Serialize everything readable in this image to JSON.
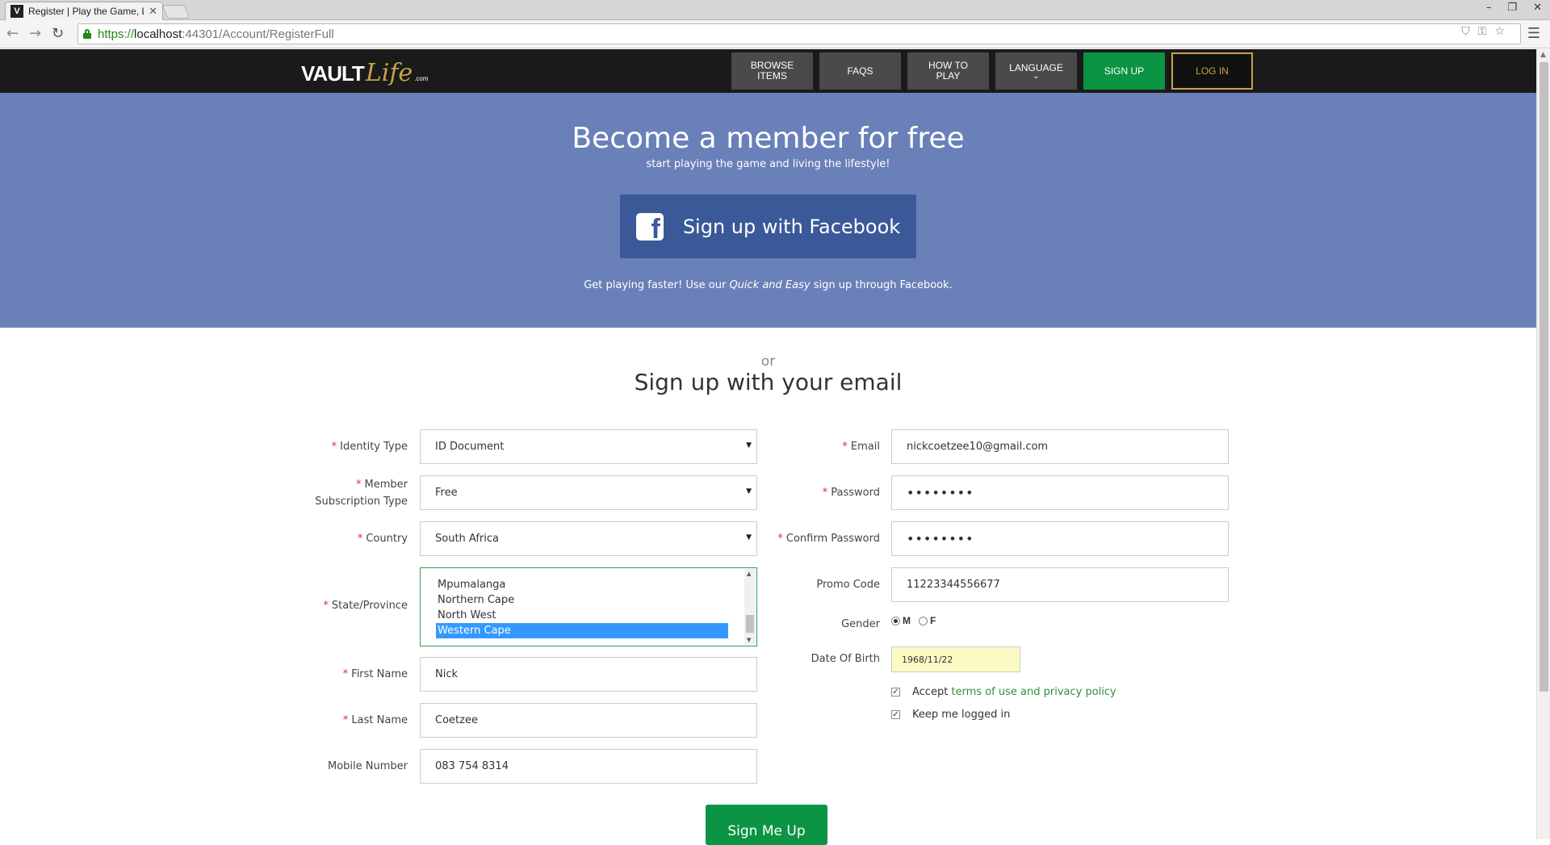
{
  "browser": {
    "tab_title": "Register | Play the Game, L",
    "tab_favicon": "V",
    "tab_close": "✕",
    "url_scheme": "https://",
    "url_host": "localhost",
    "url_rest": ":44301/Account/RegisterFull"
  },
  "nav": {
    "logo_vault": "VAULT",
    "logo_life": "Life",
    "logo_com": ".com",
    "browse_items": "BROWSE ITEMS",
    "faqs": "FAQS",
    "how_to_play": "HOW TO PLAY",
    "language": "LANGUAGE",
    "sign_up": "SIGN UP",
    "log_in": "LOG IN"
  },
  "hero": {
    "title": "Become a member for free",
    "subtitle": "start playing the game and living the lifestyle!",
    "facebook_button": "Sign up with Facebook",
    "note_before": "Get playing faster! Use our ",
    "note_em": "Quick and Easy",
    "note_after": " sign up through Facebook."
  },
  "form": {
    "or": "or",
    "title": "Sign up with your email",
    "identity_type": {
      "label": "Identity Type",
      "value": "ID Document"
    },
    "subscription_type": {
      "label_line1": "Member",
      "label_line2": "Subscription Type",
      "value": "Free"
    },
    "country": {
      "label": "Country",
      "value": "South Africa"
    },
    "state": {
      "label": "State/Province",
      "options": [
        "Mpumalanga",
        "Northern Cape",
        "North West",
        "Western Cape"
      ],
      "selected": "Western Cape"
    },
    "first_name": {
      "label": "First Name",
      "value": "Nick"
    },
    "last_name": {
      "label": "Last Name",
      "value": "Coetzee"
    },
    "mobile": {
      "label": "Mobile Number",
      "value": "083 754 8314"
    },
    "email": {
      "label": "Email",
      "value": "nickcoetzee10@gmail.com"
    },
    "password": {
      "label": "Password",
      "value": "••••••••"
    },
    "confirm_password": {
      "label": "Confirm Password",
      "value": "••••••••"
    },
    "promo_code": {
      "label": "Promo Code",
      "value": "11223344556677"
    },
    "gender": {
      "label": "Gender",
      "option_m": "M",
      "option_f": "F",
      "selected": "M"
    },
    "dob": {
      "label": "Date Of Birth",
      "value": "1968/11/22"
    },
    "accept_terms": {
      "prefix": "Accept ",
      "link": "terms of use and privacy policy",
      "checked": true
    },
    "keep_logged_in": {
      "label": "Keep me logged in",
      "checked": true
    },
    "submit": "Sign Me Up"
  },
  "colors": {
    "hero_bg": "#6a80b9",
    "facebook_blue": "#3b5998",
    "green": "#0b9444",
    "gold": "#c9a24a",
    "nav_bg": "#1a1a1a"
  }
}
